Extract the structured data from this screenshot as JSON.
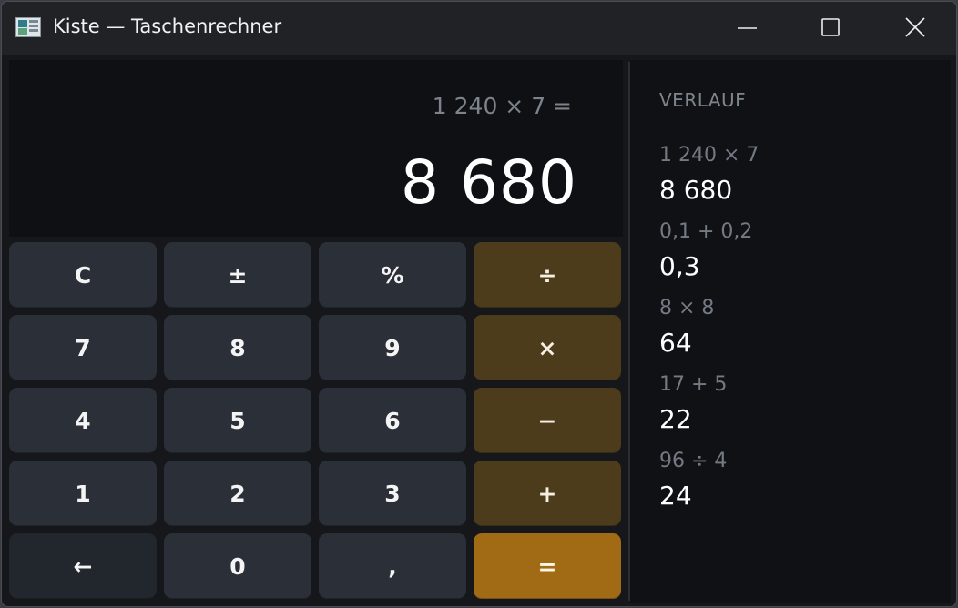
{
  "window": {
    "title": "Kiste — Taschenrechner"
  },
  "display": {
    "expression": "1 240 × 7 =",
    "result": "8 680"
  },
  "keypad": {
    "rows": [
      [
        {
          "label": "C",
          "name": "clear-button",
          "kind": "func"
        },
        {
          "label": "±",
          "name": "sign-toggle-button",
          "kind": "func"
        },
        {
          "label": "%",
          "name": "percent-button",
          "kind": "func"
        },
        {
          "label": "÷",
          "name": "divide-button",
          "kind": "op"
        }
      ],
      [
        {
          "label": "7",
          "name": "digit-7-button",
          "kind": "num"
        },
        {
          "label": "8",
          "name": "digit-8-button",
          "kind": "num"
        },
        {
          "label": "9",
          "name": "digit-9-button",
          "kind": "num"
        },
        {
          "label": "×",
          "name": "multiply-button",
          "kind": "op"
        }
      ],
      [
        {
          "label": "4",
          "name": "digit-4-button",
          "kind": "num"
        },
        {
          "label": "5",
          "name": "digit-5-button",
          "kind": "num"
        },
        {
          "label": "6",
          "name": "digit-6-button",
          "kind": "num"
        },
        {
          "label": "−",
          "name": "subtract-button",
          "kind": "op"
        }
      ],
      [
        {
          "label": "1",
          "name": "digit-1-button",
          "kind": "num"
        },
        {
          "label": "2",
          "name": "digit-2-button",
          "kind": "num"
        },
        {
          "label": "3",
          "name": "digit-3-button",
          "kind": "num"
        },
        {
          "label": "+",
          "name": "add-button",
          "kind": "op"
        }
      ],
      [
        {
          "label": "←",
          "name": "backspace-button",
          "kind": "dark"
        },
        {
          "label": "0",
          "name": "digit-0-button",
          "kind": "num"
        },
        {
          "label": ",",
          "name": "decimal-comma-button",
          "kind": "num"
        },
        {
          "label": "=",
          "name": "equals-button",
          "kind": "eq"
        }
      ]
    ]
  },
  "history": {
    "heading": "VERLAUF",
    "entries": [
      {
        "expression": "1 240 × 7",
        "result": "8 680"
      },
      {
        "expression": "0,1 + 0,2",
        "result": "0,3"
      },
      {
        "expression": "8 × 8",
        "result": "64"
      },
      {
        "expression": "17 + 5",
        "result": "22"
      },
      {
        "expression": "96 ÷ 4",
        "result": "24"
      }
    ]
  },
  "colors": {
    "operator_key": "#4d3c1c",
    "equals_key": "#a16a14",
    "number_key": "#2b3038",
    "display_bg": "#0e1014"
  },
  "icons": {
    "app": "app-icon",
    "minimize": "minimize-icon",
    "maximize": "maximize-icon",
    "close": "close-icon"
  }
}
